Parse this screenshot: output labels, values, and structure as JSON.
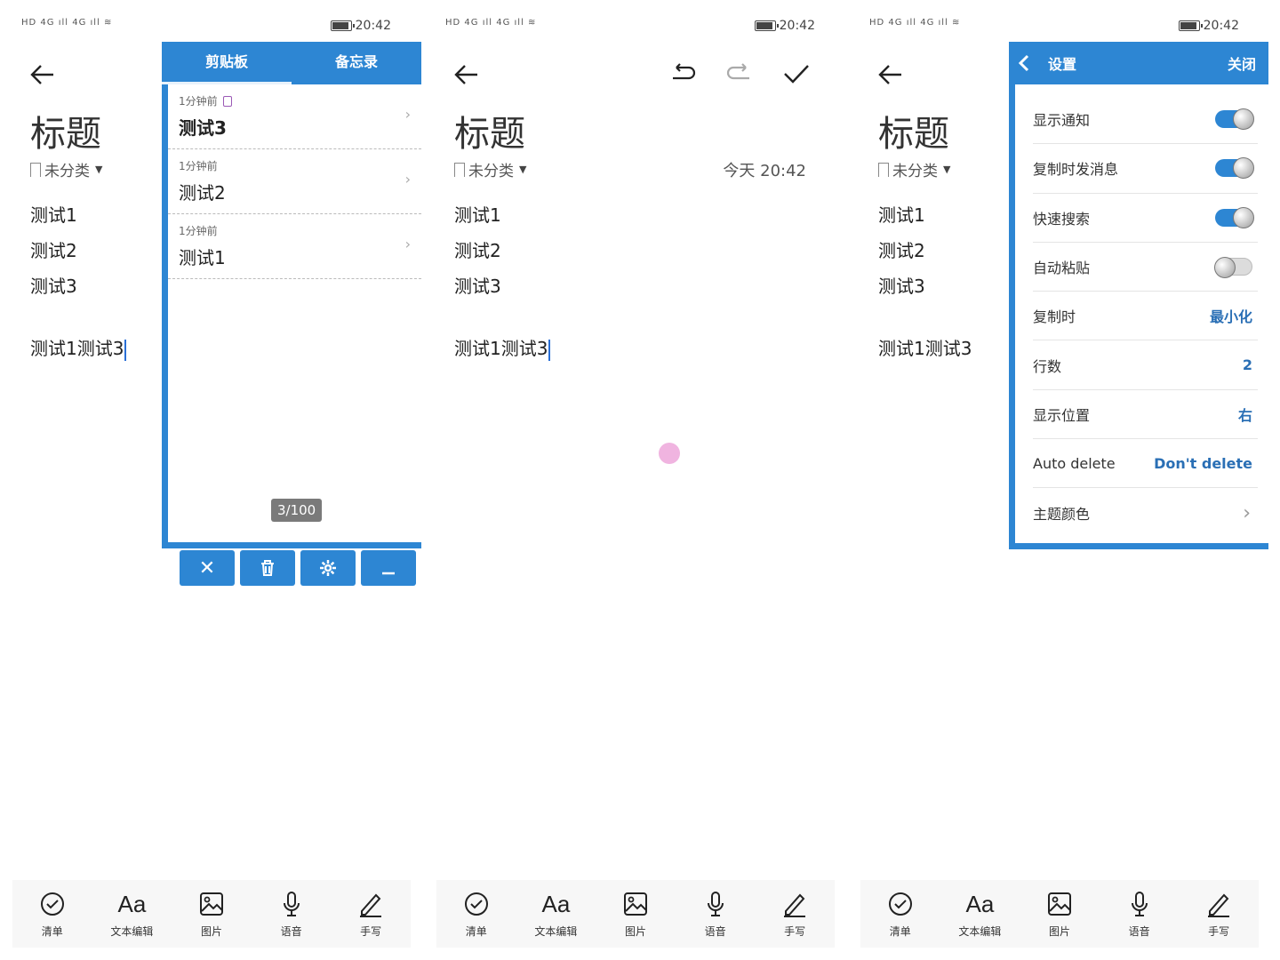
{
  "status": {
    "time": "20:42",
    "signal": "HD 4G ıll 4G ıll ≋"
  },
  "note": {
    "title": "标题",
    "category": "未分类",
    "lines": [
      "测试1",
      "测试2",
      "测试3"
    ],
    "typed": "测试1测试3",
    "date": "今天 20:42"
  },
  "toolbar": [
    {
      "label": "清单",
      "icon": "checklist-icon"
    },
    {
      "label": "文本编辑",
      "icon": "text-format-icon",
      "glyph": "Aa"
    },
    {
      "label": "图片",
      "icon": "image-icon"
    },
    {
      "label": "语音",
      "icon": "microphone-icon"
    },
    {
      "label": "手写",
      "icon": "handwriting-icon"
    }
  ],
  "clipboard": {
    "tabs": [
      "剪贴板",
      "备忘录"
    ],
    "items": [
      {
        "time": "1分钟前",
        "text": "测试3"
      },
      {
        "time": "1分钟前",
        "text": "测试2"
      },
      {
        "time": "1分钟前",
        "text": "测试1"
      }
    ],
    "counter": "3/100",
    "buttons": [
      "✕",
      "🗑",
      "⚙",
      "—"
    ]
  },
  "settings": {
    "title": "设置",
    "close": "关闭",
    "rows": [
      {
        "label": "显示通知",
        "type": "toggle",
        "on": true
      },
      {
        "label": "复制时发消息",
        "type": "toggle",
        "on": true
      },
      {
        "label": "快速搜索",
        "type": "toggle",
        "on": true
      },
      {
        "label": "自动粘贴",
        "type": "toggle",
        "on": false
      },
      {
        "label": "复制时",
        "type": "value",
        "value": "最小化"
      },
      {
        "label": "行数",
        "type": "value",
        "value": "2"
      },
      {
        "label": "显示位置",
        "type": "value",
        "value": "右"
      },
      {
        "label": "Auto delete",
        "type": "value",
        "value": "Don't delete"
      },
      {
        "label": "主题颜色",
        "type": "chevron"
      }
    ]
  },
  "colors": {
    "accent": "#2d86d3",
    "counter_bg": "#7a7a7a",
    "dot": "#f0b4e0"
  }
}
